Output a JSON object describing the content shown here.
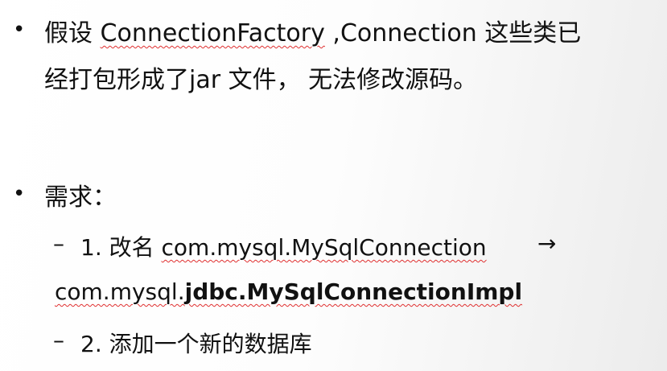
{
  "bullets": [
    {
      "marker": "•",
      "line1_prefix": "假设 ",
      "line1_term": "ConnectionFactory",
      "line1_suffix": " ,Connection 这些类已",
      "line2": "经打包形成了jar 文件， 无法修改源码。"
    },
    {
      "marker": "•",
      "text": "需求："
    }
  ],
  "sub_items": [
    {
      "marker": "–",
      "prefix": "1. 改名 ",
      "from": "com.mysql.MySqlConnection",
      "arrow": "→",
      "to_plain": "com.mysql.",
      "to_bold": "jdbc.MySqlConnectionImpl"
    },
    {
      "marker": "–",
      "text": "2.  添加一个新的数据库"
    }
  ],
  "colors": {
    "spellcheck_underline": "#e03030",
    "text": "#111111"
  }
}
